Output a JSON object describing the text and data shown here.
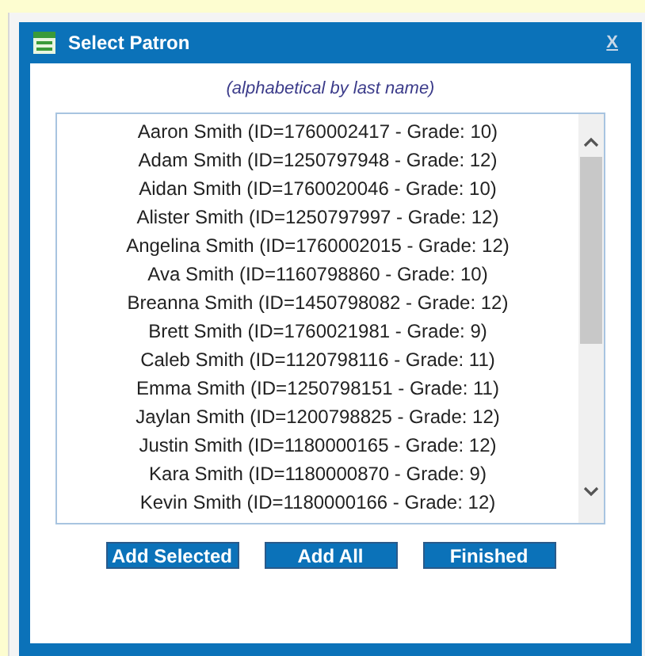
{
  "dialog": {
    "title": "Select Patron",
    "close": "X",
    "note": "(alphabetical by last name)",
    "patrons": [
      {
        "label": "Aaron Smith (ID=1760002417 - Grade: 10)",
        "selected": false
      },
      {
        "label": "Adam Smith (ID=1250797948 - Grade: 12)",
        "selected": false
      },
      {
        "label": "Aidan Smith (ID=1760020046 - Grade: 10)",
        "selected": false
      },
      {
        "label": "Alister Smith (ID=1250797997 - Grade: 12)",
        "selected": false
      },
      {
        "label": "Angelina Smith (ID=1760002015 - Grade: 12)",
        "selected": false
      },
      {
        "label": "Ava Smith (ID=1160798860 - Grade: 10)",
        "selected": false
      },
      {
        "label": "Breanna Smith (ID=1450798082 - Grade: 12)",
        "selected": false
      },
      {
        "label": "Brett Smith (ID=1760021981 - Grade: 9)",
        "selected": false
      },
      {
        "label": "Caleb Smith (ID=1120798116 - Grade: 11)",
        "selected": false
      },
      {
        "label": "Emma Smith (ID=1250798151 - Grade: 11)",
        "selected": false
      },
      {
        "label": "Jaylan Smith (ID=1200798825 - Grade: 12)",
        "selected": false
      },
      {
        "label": "Justin Smith (ID=1180000165 - Grade: 12)",
        "selected": false
      },
      {
        "label": "Kara Smith (ID=1180000870 - Grade: 9)",
        "selected": false
      },
      {
        "label": "Kevin Smith (ID=1180000166 - Grade: 12)",
        "selected": false
      }
    ],
    "buttons": [
      "Add Selected",
      "Add All",
      "Finished"
    ]
  }
}
